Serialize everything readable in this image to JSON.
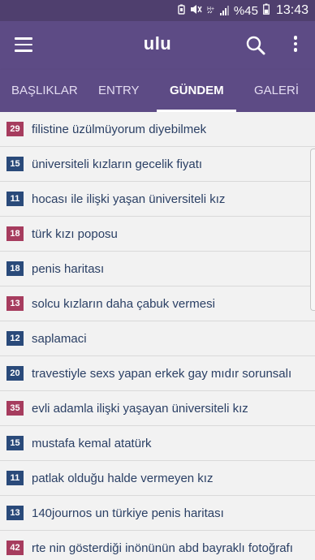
{
  "status_bar": {
    "icons": [
      "battery-saver-icon",
      "mute-icon",
      "no-wifi-icon",
      "signal-icon"
    ],
    "signal_label": "H+",
    "battery": "%45",
    "time": "13:43"
  },
  "app": {
    "title": "ulu",
    "colors": {
      "toolbar": "#5d4b85",
      "statusbar": "#4f3f6e",
      "badge_blue": "#2a4a7a",
      "badge_red": "#a63c5e"
    }
  },
  "tabs": [
    {
      "label": "BAŞLIKLAR",
      "active": false
    },
    {
      "label": "ENTRY",
      "active": false
    },
    {
      "label": "GÜNDEM",
      "active": true
    },
    {
      "label": "GALERİ",
      "active": false
    }
  ],
  "topics": [
    {
      "count": "29",
      "title": "filistine üzülmüyorum diyebilmek",
      "color": "#a63c5e"
    },
    {
      "count": "15",
      "title": "üniversiteli kızların gecelik fiyatı",
      "color": "#2a4a7a"
    },
    {
      "count": "11",
      "title": "hocası ile ilişki yaşan üniversiteli kız",
      "color": "#2a4a7a"
    },
    {
      "count": "18",
      "title": "türk kızı poposu",
      "color": "#a63c5e"
    },
    {
      "count": "18",
      "title": "penis haritası",
      "color": "#2a4a7a"
    },
    {
      "count": "13",
      "title": "solcu kızların daha çabuk vermesi",
      "color": "#a63c5e"
    },
    {
      "count": "12",
      "title": "saplamaci",
      "color": "#2a4a7a"
    },
    {
      "count": "20",
      "title": "travestiyle sexs yapan erkek gay mıdır sorunsalı",
      "color": "#2a4a7a"
    },
    {
      "count": "35",
      "title": "evli adamla ilişki yaşayan üniversiteli kız",
      "color": "#a63c5e"
    },
    {
      "count": "15",
      "title": "mustafa kemal atatürk",
      "color": "#2a4a7a"
    },
    {
      "count": "11",
      "title": "patlak olduğu halde vermeyen kız",
      "color": "#2a4a7a"
    },
    {
      "count": "13",
      "title": "140journos un türkiye penis haritası",
      "color": "#2a4a7a"
    },
    {
      "count": "42",
      "title": "rte nin gösterdiği inönünün abd bayraklı fotoğrafı",
      "color": "#a63c5e"
    }
  ]
}
